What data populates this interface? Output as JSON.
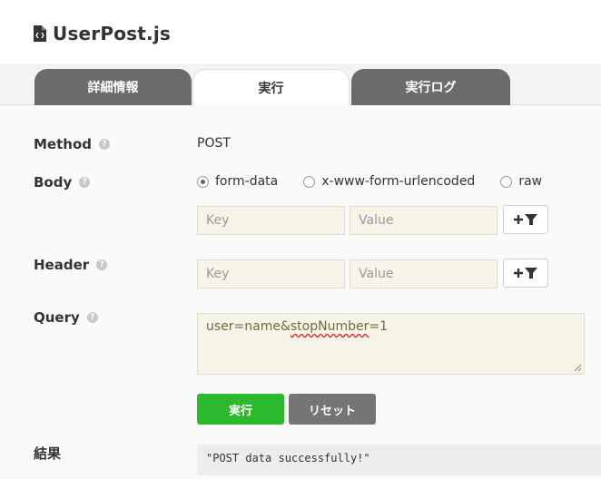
{
  "header": {
    "title": "UserPost.js",
    "icon": "js-file-icon"
  },
  "tabs": [
    {
      "label": "詳細情報",
      "active": false
    },
    {
      "label": "実行",
      "active": true
    },
    {
      "label": "実行ログ",
      "active": false
    }
  ],
  "form": {
    "method": {
      "label": "Method",
      "help": "?",
      "value": "POST"
    },
    "body": {
      "label": "Body",
      "help": "?",
      "options": [
        {
          "label": "form-data",
          "selected": true
        },
        {
          "label": "x-www-form-urlencoded",
          "selected": false
        },
        {
          "label": "raw",
          "selected": false
        }
      ],
      "key_placeholder": "Key",
      "value_placeholder": "Value"
    },
    "header": {
      "label": "Header",
      "help": "?",
      "key_placeholder": "Key",
      "value_placeholder": "Value"
    },
    "query": {
      "label": "Query",
      "help": "?",
      "value_prefix": "user=name&",
      "value_misspelled": "stopNumber",
      "value_suffix": "=1"
    },
    "add_button": "+ filter-icon"
  },
  "actions": {
    "run": "実行",
    "reset": "リセット"
  },
  "result": {
    "label": "結果",
    "value": "\"POST data successfully!\""
  },
  "colors": {
    "run": "#2db92d",
    "reset": "#757575",
    "tab_inactive": "#6b6b6b",
    "input_bg": "#f5f4e6"
  }
}
